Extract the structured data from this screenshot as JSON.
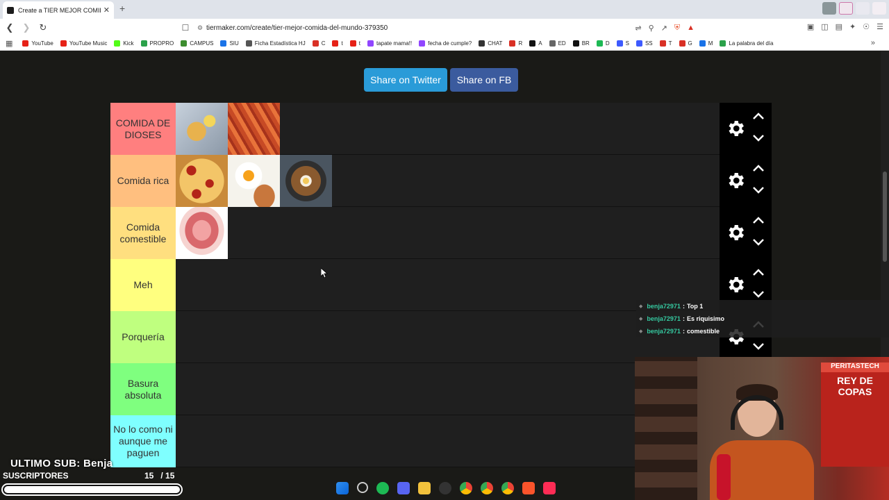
{
  "browser": {
    "tab_title": "Create a TIER MEJOR COMIDA D",
    "tab_close": "✕",
    "new_tab": "+",
    "url": "tiermaker.com/create/tier-mejor-comida-del-mundo-379350",
    "icons": [
      "back-icon",
      "forward-icon",
      "reload-icon",
      "bookmark-icon",
      "site-info-icon",
      "translate-icon",
      "zoom-icon",
      "share-icon",
      "brave-shield-icon",
      "rewards-icon"
    ]
  },
  "bookmarks": [
    {
      "label": "YouTube",
      "color": "#e62117"
    },
    {
      "label": "YouTube Music",
      "color": "#e62117"
    },
    {
      "label": "Kick",
      "color": "#53fc18"
    },
    {
      "label": "PROPRO",
      "color": "#2aa14a"
    },
    {
      "label": "CAMPUS",
      "color": "#3c8d2f"
    },
    {
      "label": "SIU",
      "color": "#1a73e8"
    },
    {
      "label": "Ficha Estadística HJ",
      "color": "#555555"
    },
    {
      "label": "C",
      "color": "#d93025"
    },
    {
      "label": "t",
      "color": "#e62117"
    },
    {
      "label": "t",
      "color": "#e62117"
    },
    {
      "label": "tapate mama!!",
      "color": "#9146ff"
    },
    {
      "label": "fecha de cumple?",
      "color": "#9146ff"
    },
    {
      "label": "CHAT",
      "color": "#333333"
    },
    {
      "label": "R",
      "color": "#d93025"
    },
    {
      "label": "A",
      "color": "#111111"
    },
    {
      "label": "ED",
      "color": "#666666"
    },
    {
      "label": "BR",
      "color": "#111111"
    },
    {
      "label": "D",
      "color": "#1db954"
    },
    {
      "label": "S",
      "color": "#3d5afe"
    },
    {
      "label": "SS",
      "color": "#3d5afe"
    },
    {
      "label": "T",
      "color": "#d93025"
    },
    {
      "label": "G",
      "color": "#d93025"
    },
    {
      "label": "M",
      "color": "#1a73e8"
    },
    {
      "label": "La palabra del día",
      "color": "#2aa14a"
    }
  ],
  "share": {
    "twitter": "Share on Twitter",
    "facebook": "Share on FB"
  },
  "tiers": [
    {
      "label": "COMIDA DE DIOSES",
      "color": "#ff7f7f",
      "items": [
        "milanesa",
        "pasta"
      ]
    },
    {
      "label": "Comida rica",
      "color": "#ffbf7f",
      "items": [
        "pizza",
        "eggs",
        "ramen"
      ]
    },
    {
      "label": "Comida comestible",
      "color": "#ffdf7f",
      "items": [
        "jamon"
      ]
    },
    {
      "label": "Meh",
      "color": "#ffff7f",
      "items": []
    },
    {
      "label": "Porquería",
      "color": "#bfff7f",
      "items": []
    },
    {
      "label": "Basura absoluta",
      "color": "#7fff7f",
      "items": []
    },
    {
      "label": "No lo como ni aunque me paguen",
      "color": "#7fffff",
      "items": []
    }
  ],
  "chat": [
    {
      "user": "benja72971",
      "sep": ":",
      "msg": "Top 1"
    },
    {
      "user": "benja72971",
      "sep": ":",
      "msg": "Es riquisimo"
    },
    {
      "user": "benja72971",
      "sep": ":",
      "msg": "comestible"
    }
  ],
  "stream": {
    "last_sub_label": "ULTIMO SUB: Benja",
    "subs_title": "SUSCRIPTORES",
    "subs_count": "15   / 15",
    "subs_progress": 1.0,
    "banner_top": "PERITASTECH",
    "banner_text": "REY DE COPAS"
  }
}
